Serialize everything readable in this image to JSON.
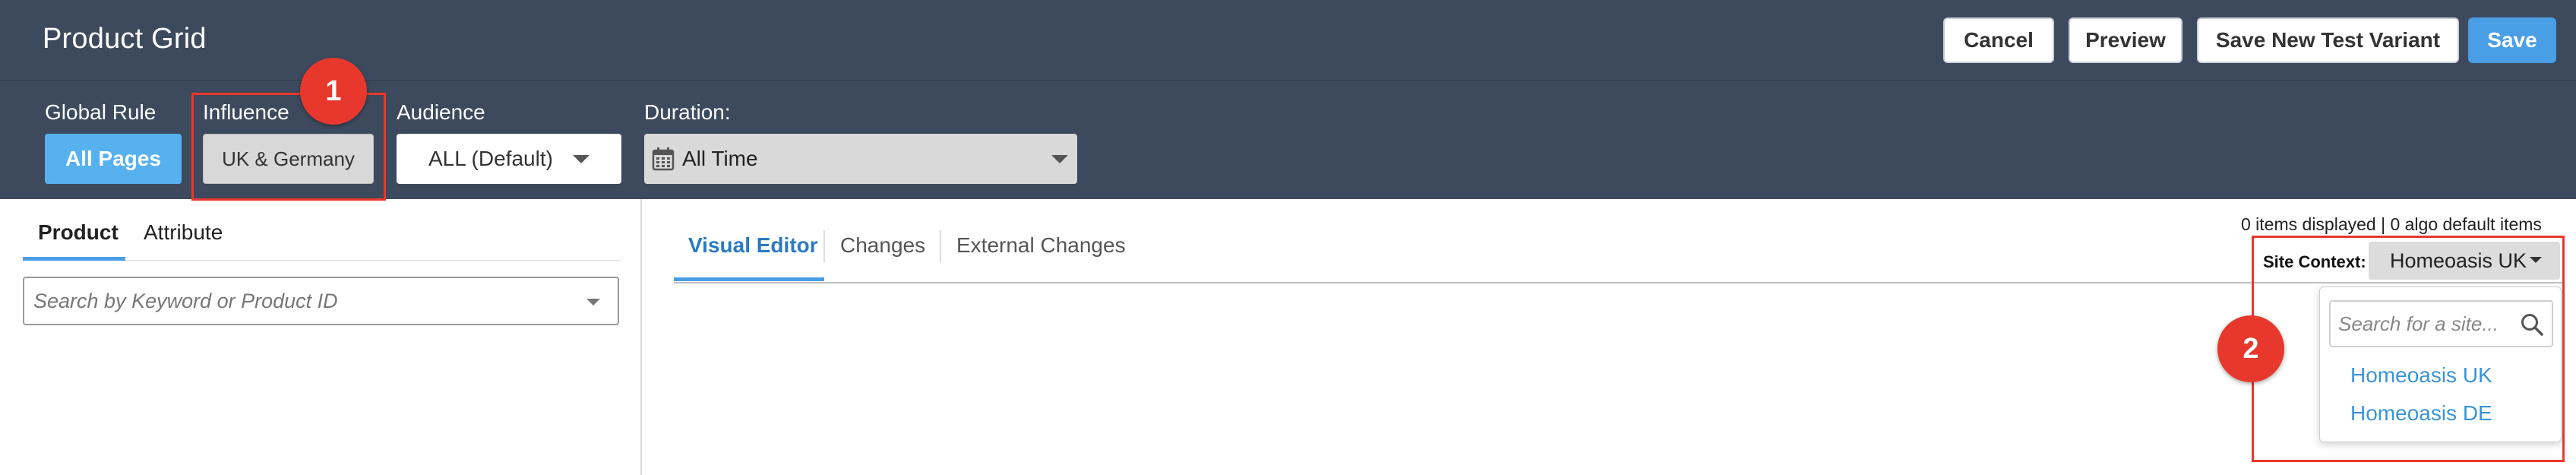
{
  "header": {
    "title": "Product Grid",
    "buttons": {
      "cancel": "Cancel",
      "preview": "Preview",
      "save_new_variant": "Save New Test Variant",
      "save": "Save"
    }
  },
  "settings": {
    "global_rule": {
      "label": "Global Rule",
      "value": "All Pages"
    },
    "influence": {
      "label": "Influence",
      "value": "UK & Germany"
    },
    "audience": {
      "label": "Audience",
      "value": "ALL (Default)"
    },
    "duration": {
      "label": "Duration:",
      "value": "All Time"
    }
  },
  "left_panel": {
    "tabs": [
      "Product",
      "Attribute"
    ],
    "active_tab": "Product",
    "search_placeholder": "Search by Keyword or Product ID"
  },
  "right_panel": {
    "items_status": "0 items displayed | 0 algo default items",
    "tabs": [
      "Visual Editor",
      "Changes",
      "External Changes"
    ],
    "active_tab": "Visual Editor",
    "site_context": {
      "label": "Site Context:",
      "selected": "Homeoasis UK",
      "search_placeholder": "Search for a site...",
      "options": [
        "Homeoasis UK",
        "Homeoasis DE"
      ]
    }
  },
  "annotations": {
    "marker_1": "1",
    "marker_2": "2"
  },
  "colors": {
    "header_bg": "#3d4a5e",
    "primary_blue": "#4a9ee6",
    "light_blue_button": "#58b1ef",
    "link_blue": "#3a95d6",
    "annotation_red": "#e8382d"
  },
  "icons": {
    "duration": "calendar-icon",
    "site_search": "search-icon",
    "dropdowns": "caret-down-icon"
  }
}
